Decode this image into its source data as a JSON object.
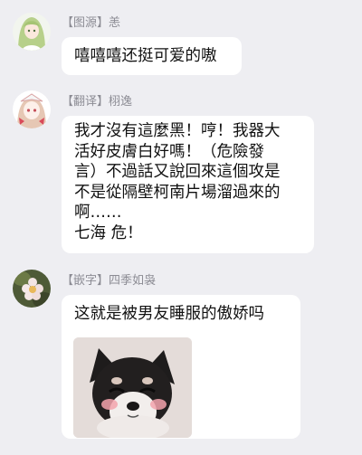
{
  "messages": [
    {
      "sender": "【图源】恙",
      "lines": [
        "嘻嘻嘻还挺可爱的嗷"
      ]
    },
    {
      "sender": "【翻译】栩逸",
      "lines": [
        "我才沒有這麼黑！哼！我器大",
        "活好皮膚白好嗎！（危險發",
        "言）不過話又說回來這個攻是",
        "不是從隔壁柯南片場溜過來的",
        "啊……",
        "七海 危！"
      ]
    },
    {
      "sender": "【嵌字】四季如袅",
      "lines": [
        "这就是被男友睡服的傲娇吗"
      ],
      "image": "shiba-dog-sticker"
    }
  ]
}
